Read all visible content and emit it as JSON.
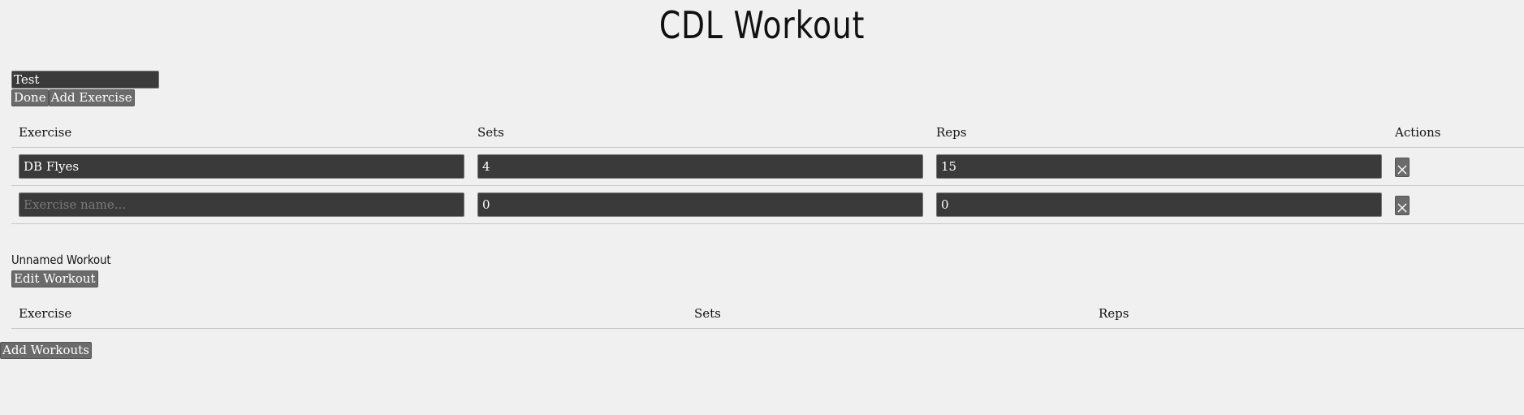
{
  "title": "CDL Workout",
  "workout_editor": {
    "name_value": "Test",
    "done_label": "Done",
    "add_exercise_label": "Add Exercise",
    "headers": [
      "Exercise",
      "Sets",
      "Reps",
      "Actions"
    ],
    "rows": [
      {
        "exercise": "DB Flyes",
        "sets": "4",
        "reps": "15",
        "placeholder": ""
      },
      {
        "exercise": "",
        "sets": "0",
        "reps": "0",
        "placeholder": "Exercise name..."
      }
    ]
  },
  "workout_view": {
    "title": "Unnamed Workout",
    "edit_label": "Edit Workout",
    "headers": [
      "Exercise",
      "Sets",
      "Reps"
    ]
  },
  "add_workouts_label": "Add Workouts",
  "icons": {
    "delete": "close-icon"
  },
  "colors": {
    "background": "#f0f0f0",
    "input_bg": "#3a3a3a",
    "button_bg": "#6b6b6b"
  }
}
